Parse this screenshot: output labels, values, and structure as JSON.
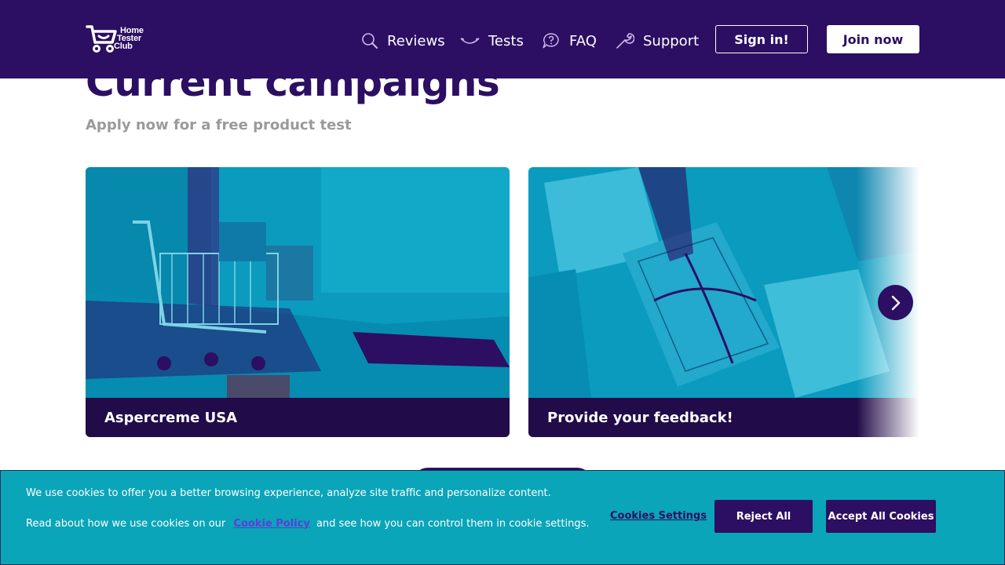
{
  "header": {
    "logo_lines": [
      "Home",
      "Tester",
      "Club"
    ],
    "nav": [
      {
        "label": "Reviews",
        "icon": "magnifier-icon"
      },
      {
        "label": "Tests",
        "icon": "smile-icon"
      },
      {
        "label": "FAQ",
        "icon": "question-bubble-icon"
      },
      {
        "label": "Support",
        "icon": "wrench-icon"
      }
    ],
    "signin_label": "Sign in!",
    "join_label": "Join now"
  },
  "section": {
    "title": "Current campaigns",
    "subtitle": "Apply now for a free product test"
  },
  "campaigns": [
    {
      "title": "Aspercreme USA"
    },
    {
      "title": "Provide your feedback!"
    }
  ],
  "cookie": {
    "line1": "We use cookies to offer you a better browsing experience, analyze site traffic and personalize content.",
    "line2_pre": "Read about how we use cookies on our",
    "link": "Cookie Policy",
    "line2_post": "and see how you can control them in cookie settings.",
    "settings_label": "Cookies Settings",
    "reject_label": "Reject All",
    "accept_label": "Accept All Cookies"
  },
  "colors": {
    "brand": "#2c0e63",
    "cookie_bg": "#0aa5b8",
    "card_footer": "#210b48"
  }
}
